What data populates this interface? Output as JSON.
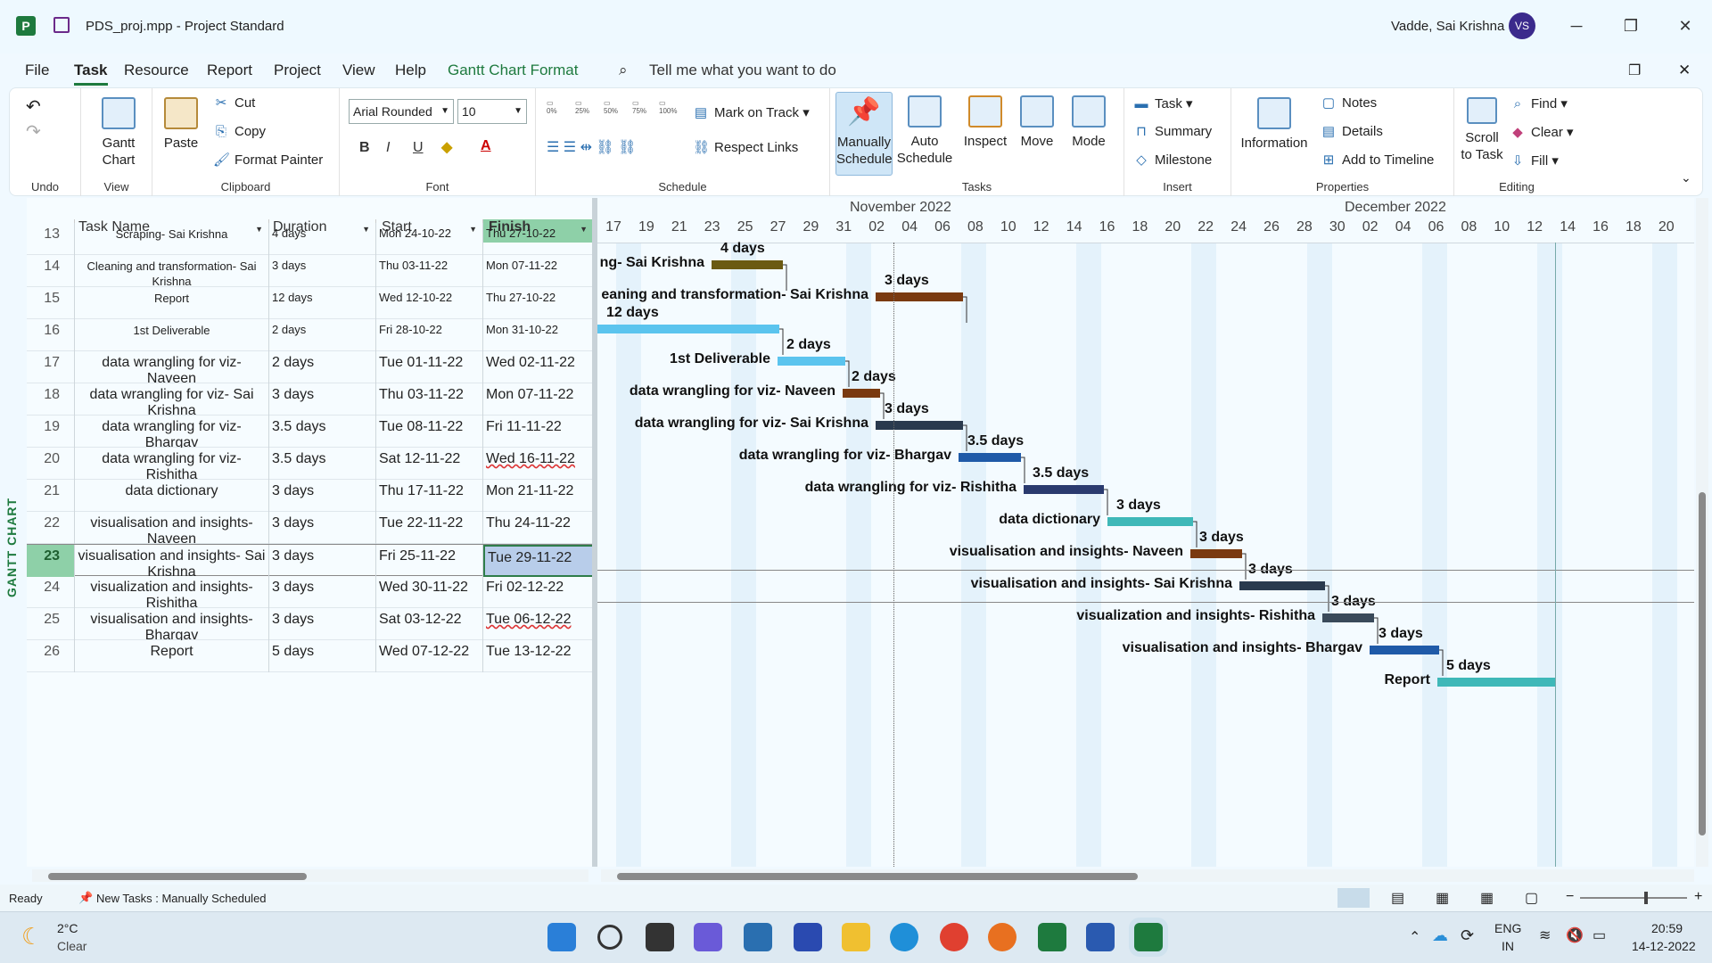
{
  "window": {
    "title": "PDS_proj.mpp - Project Standard",
    "user_name": "Vadde, Sai Krishna",
    "user_initials": "VS",
    "minimize": "─",
    "restore": "❐",
    "close": "✕"
  },
  "menu": {
    "items": [
      "File",
      "Task",
      "Resource",
      "Report",
      "Project",
      "View",
      "Help",
      "Gantt Chart Format"
    ],
    "active": "Task",
    "tell_me": "Tell me what you want to do"
  },
  "ribbon": {
    "groups": {
      "undo": "Undo",
      "view": "View",
      "clipboard": "Clipboard",
      "font": "Font",
      "schedule": "Schedule",
      "tasks": "Tasks",
      "insert": "Insert",
      "properties": "Properties",
      "editing": "Editing"
    },
    "gantt_chart": "Gantt Chart",
    "paste": "Paste",
    "cut": "Cut",
    "copy": "Copy",
    "format_painter": "Format Painter",
    "font_name": "Arial Rounded",
    "font_size": "10",
    "bold": "B",
    "italic": "I",
    "underline": "U",
    "pct_buttons": [
      "0%",
      "25%",
      "50%",
      "75%",
      "100%"
    ],
    "mark_on_track": "Mark on Track",
    "respect_links": "Respect Links",
    "manually_schedule": "Manually Schedule",
    "auto_schedule": "Auto Schedule",
    "inspect": "Inspect",
    "move": "Move",
    "mode": "Mode",
    "task": "Task",
    "summary": "Summary",
    "milestone": "Milestone",
    "information": "Information",
    "notes": "Notes",
    "details": "Details",
    "add_to_timeline": "Add to Timeline",
    "scroll_to_task": "Scroll to Task",
    "find": "Find",
    "clear": "Clear",
    "fill": "Fill"
  },
  "side_label": "GANTT CHART",
  "table": {
    "headers": {
      "task_name": "Task Name",
      "duration": "Duration",
      "start": "Start",
      "finish": "Finish"
    },
    "rows": [
      {
        "id": "13",
        "name": "Scraping- Sai Krishna",
        "duration": "4 days",
        "start": "Mon 24-10-22",
        "finish": "Thu 27-10-22",
        "small": true
      },
      {
        "id": "14",
        "name": "Cleaning and transformation- Sai Krishna",
        "duration": "3 days",
        "start": "Thu 03-11-22",
        "finish": "Mon 07-11-22",
        "small": true
      },
      {
        "id": "15",
        "name": "Report",
        "duration": "12 days",
        "start": "Wed 12-10-22",
        "finish": "Thu 27-10-22",
        "small": true
      },
      {
        "id": "16",
        "name": "1st Deliverable",
        "duration": "2 days",
        "start": "Fri 28-10-22",
        "finish": "Mon 31-10-22",
        "small": true
      },
      {
        "id": "17",
        "name": "data wrangling for viz- Naveen",
        "duration": "2 days",
        "start": "Tue 01-11-22",
        "finish": "Wed 02-11-22"
      },
      {
        "id": "18",
        "name": "data wrangling for viz- Sai Krishna",
        "duration": "3 days",
        "start": "Thu 03-11-22",
        "finish": "Mon 07-11-22"
      },
      {
        "id": "19",
        "name": "data wrangling for viz- Bhargav",
        "duration": "3.5 days",
        "start": "Tue 08-11-22",
        "finish": "Fri 11-11-22"
      },
      {
        "id": "20",
        "name": "data wrangling for viz- Rishitha",
        "duration": "3.5 days",
        "start": "Sat 12-11-22",
        "finish": "Wed 16-11-22",
        "flag": true
      },
      {
        "id": "21",
        "name": "data dictionary",
        "duration": "3 days",
        "start": "Thu 17-11-22",
        "finish": "Mon 21-11-22"
      },
      {
        "id": "22",
        "name": "visualisation and insights- Naveen",
        "duration": "3 days",
        "start": "Tue 22-11-22",
        "finish": "Thu 24-11-22"
      },
      {
        "id": "23",
        "name": "visualisation and insights- Sai Krishna",
        "duration": "3 days",
        "start": "Fri 25-11-22",
        "finish": "Tue 29-11-22",
        "selected": true
      },
      {
        "id": "24",
        "name": "visualization and insights- Rishitha",
        "duration": "3 days",
        "start": "Wed 30-11-22",
        "finish": "Fri 02-12-22"
      },
      {
        "id": "25",
        "name": "visualisation and insights- Bhargav",
        "duration": "3 days",
        "start": "Sat 03-12-22",
        "finish": "Tue 06-12-22",
        "flag": true
      },
      {
        "id": "26",
        "name": "Report",
        "duration": "5 days",
        "start": "Wed 07-12-22",
        "finish": "Tue 13-12-22"
      }
    ]
  },
  "timescale": {
    "months": [
      "November 2022",
      "December 2022"
    ],
    "days": [
      "17",
      "19",
      "21",
      "23",
      "25",
      "27",
      "29",
      "31",
      "02",
      "04",
      "06",
      "08",
      "10",
      "12",
      "14",
      "16",
      "18",
      "20",
      "22",
      "24",
      "26",
      "28",
      "30",
      "02",
      "04",
      "06",
      "08",
      "10",
      "12",
      "14",
      "16",
      "18",
      "20"
    ]
  },
  "gantt_bars": [
    {
      "label": "ng- Sai Krishna",
      "duration_label": "4 days",
      "color": "#6b5a12"
    },
    {
      "label": "eaning and transformation- Sai Krishna",
      "duration_label": "3 days",
      "color": "#7a3a10"
    },
    {
      "label": "",
      "duration_label": "12 days",
      "color": "#5bc4ee"
    },
    {
      "label": "1st Deliverable",
      "duration_label": "2 days",
      "color": "#5bc4ee"
    },
    {
      "label": "data wrangling for viz- Naveen",
      "duration_label": "2 days",
      "color": "#7a3a10"
    },
    {
      "label": "data wrangling for viz- Sai Krishna",
      "duration_label": "3 days",
      "color": "#2a3a4e"
    },
    {
      "label": "data wrangling for viz- Bhargav",
      "duration_label": "3.5 days",
      "color": "#1f5aa8"
    },
    {
      "label": "data wrangling for viz- Rishitha",
      "duration_label": "3.5 days",
      "color": "#2a3a6e"
    },
    {
      "label": "data dictionary",
      "duration_label": "3 days",
      "color": "#3fb8b8"
    },
    {
      "label": "visualisation and insights- Naveen",
      "duration_label": "3 days",
      "color": "#7a3a10"
    },
    {
      "label": "visualisation and insights- Sai Krishna",
      "duration_label": "3 days",
      "color": "#2a3a4e"
    },
    {
      "label": "visualization and insights- Rishitha",
      "duration_label": "3 days",
      "color": "#3a4a5a"
    },
    {
      "label": "visualisation and insights- Bhargav",
      "duration_label": "3 days",
      "color": "#1f5aa8"
    },
    {
      "label": "Report",
      "duration_label": "5 days",
      "color": "#3fb8b8"
    }
  ],
  "status": {
    "ready": "Ready",
    "new_tasks": "New Tasks : Manually Scheduled"
  },
  "taskbar": {
    "weather_temp": "2°C",
    "weather_desc": "Clear",
    "lang_top": "ENG",
    "lang_bottom": "IN",
    "time": "20:59",
    "date": "14-12-2022"
  }
}
